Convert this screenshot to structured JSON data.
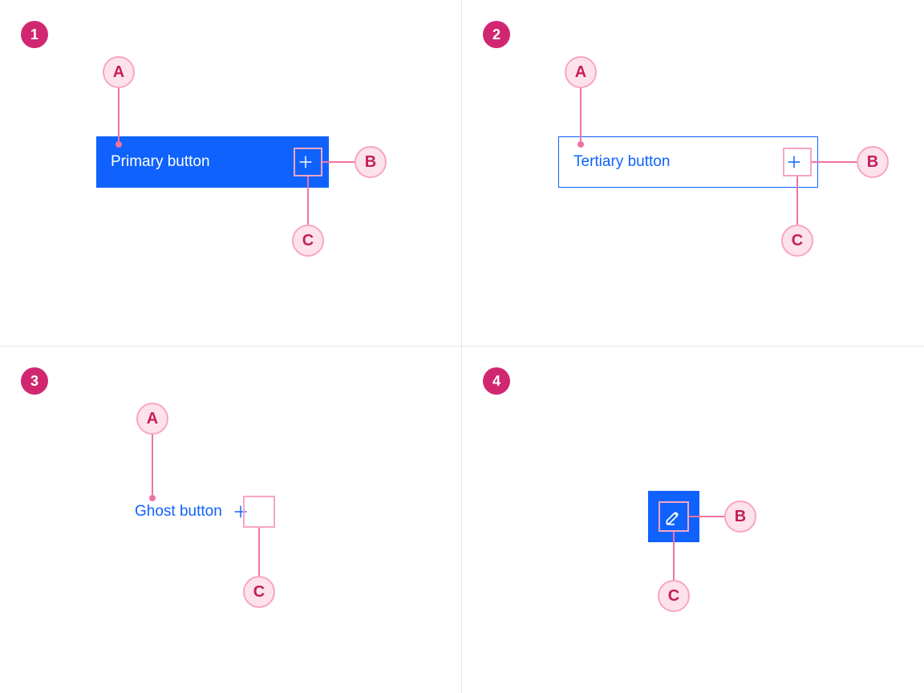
{
  "panels": {
    "p1": {
      "number": "1",
      "annotations": {
        "a": "A",
        "b": "B",
        "c": "C"
      },
      "button_label": "Primary button",
      "button_icon": "plus"
    },
    "p2": {
      "number": "2",
      "annotations": {
        "a": "A",
        "b": "B",
        "c": "C"
      },
      "button_label": "Tertiary button",
      "button_icon": "plus"
    },
    "p3": {
      "number": "3",
      "annotations": {
        "a": "A",
        "c": "C"
      },
      "button_label": "Ghost button",
      "button_icon": "plus"
    },
    "p4": {
      "number": "4",
      "annotations": {
        "b": "B",
        "c": "C"
      },
      "button_icon": "edit"
    }
  },
  "colors": {
    "primary": "#0f62fe",
    "magenta": "#d12771",
    "annot_fill": "#fde2ec",
    "annot_border": "#f8a5c2",
    "annot_text": "#c41e5a"
  }
}
